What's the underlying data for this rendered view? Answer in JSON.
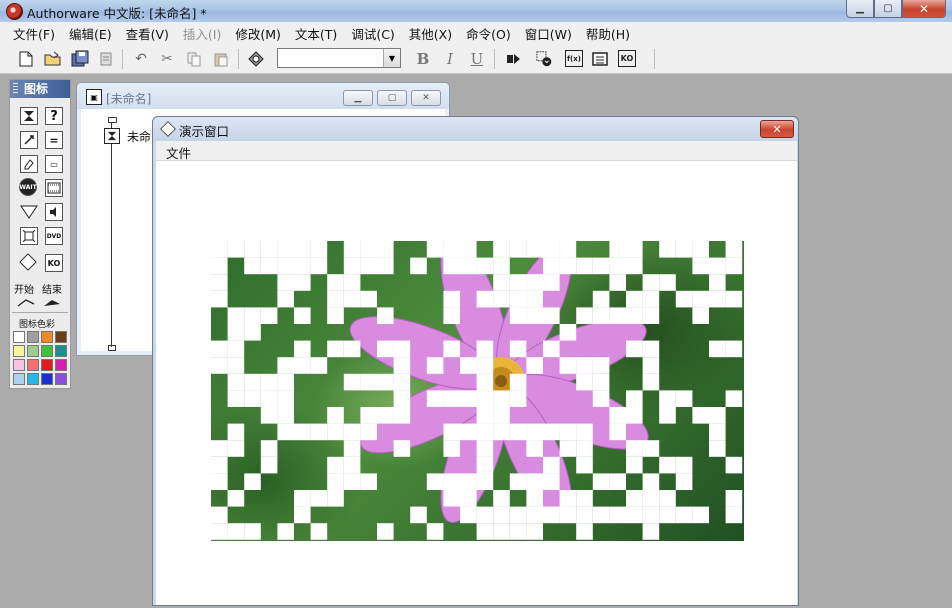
{
  "app": {
    "title": "Authorware 中文版: [未命名] *",
    "window_controls": {
      "minimize": "▁",
      "maximize": "▢",
      "close": "✕"
    }
  },
  "menubar": [
    {
      "label": "文件(F)",
      "enabled": true
    },
    {
      "label": "编辑(E)",
      "enabled": true
    },
    {
      "label": "查看(V)",
      "enabled": true
    },
    {
      "label": "插入(I)",
      "enabled": false
    },
    {
      "label": "修改(M)",
      "enabled": true
    },
    {
      "label": "文本(T)",
      "enabled": true
    },
    {
      "label": "调试(C)",
      "enabled": true
    },
    {
      "label": "其他(X)",
      "enabled": true
    },
    {
      "label": "命令(O)",
      "enabled": true
    },
    {
      "label": "窗口(W)",
      "enabled": true
    },
    {
      "label": "帮助(H)",
      "enabled": true
    }
  ],
  "toolbar": {
    "icons": [
      "new-file-icon",
      "open-folder-icon",
      "save-all-icon",
      "import-icon",
      "undo-icon",
      "cut-icon",
      "copy-icon",
      "paste-icon",
      "find-icon"
    ],
    "style_combo_value": "",
    "bold": "B",
    "italic": "I",
    "underline": "U",
    "restart_icon": "play-from-flag-icon",
    "ko_label": "KO",
    "fx_label": "f(x)"
  },
  "palette": {
    "title": "图标",
    "start_label": "开始",
    "end_label": "结束",
    "colors_label": "图标色彩",
    "wait_label": "WAIT",
    "dvd_label": "DVD",
    "ko_label": "KO",
    "swatches": [
      "#ffffff",
      "#a0a0a0",
      "#f08a24",
      "#6b3d1a",
      "#f6f39a",
      "#9ec98f",
      "#3cc43a",
      "#1b8f8f",
      "#f6c4e2",
      "#f47070",
      "#e21b1b",
      "#d61fb1",
      "#a9d3ee",
      "#25b8e6",
      "#1c2fd3",
      "#8c4fd9"
    ]
  },
  "design_window": {
    "title": "[未命名]",
    "flow_label": "未命"
  },
  "presentation_window": {
    "title": "演示窗口",
    "menu_file": "文件",
    "close": "✕"
  },
  "picture": {
    "icon_name": "flower-photo",
    "colors": {
      "petal": "#d98be0",
      "petal_dark": "#b45fc4",
      "center": "#e8b43a",
      "background": "#3f7d34"
    }
  }
}
